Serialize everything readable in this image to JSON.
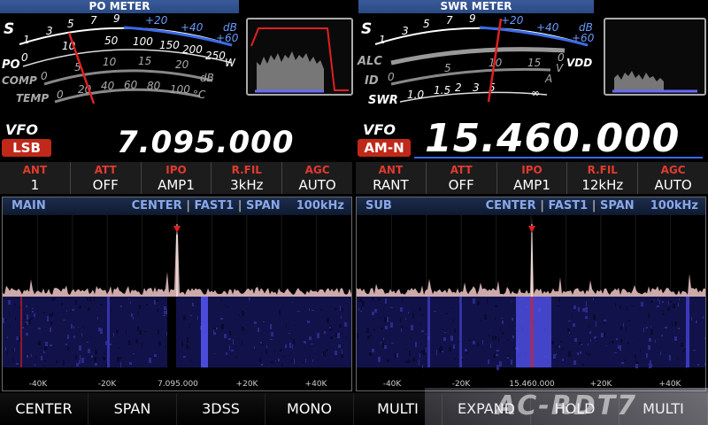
{
  "left_meter": {
    "title": "PO METER",
    "s_label": "S",
    "po_label": "PO",
    "comp_label": "COMP",
    "temp_label": "TEMP",
    "s_ticks": [
      "1",
      "3",
      "5",
      "7",
      "9",
      "+20",
      "+40",
      "+60"
    ],
    "s_unit": "dB",
    "po_ticks": [
      "0",
      "10",
      "50",
      "100",
      "150",
      "200",
      "250"
    ],
    "po_unit": "W",
    "comp_ticks": [
      "0",
      "5",
      "10",
      "15",
      "20"
    ],
    "comp_unit": "dB",
    "temp_ticks": [
      "0",
      "20",
      "40",
      "60",
      "80",
      "100"
    ],
    "temp_unit": "°C"
  },
  "right_meter": {
    "title": "SWR METER",
    "s_label": "S",
    "alc_label": "ALC",
    "id_label": "ID",
    "swr_label": "SWR",
    "vdd_label": "VDD",
    "s_ticks": [
      "1",
      "3",
      "5",
      "7",
      "9",
      "+20",
      "+40",
      "+60"
    ],
    "s_unit": "dB",
    "vdd_ticks": [
      "0",
      "50"
    ],
    "vdd_unit": "V",
    "id_ticks": [
      "0",
      "5",
      "10",
      "15"
    ],
    "id_unit": "A",
    "swr_ticks": [
      "1.0",
      "1.5",
      "2",
      "3",
      "5",
      "∞"
    ]
  },
  "main_vfo": {
    "label": "VFO",
    "mode": "LSB",
    "frequency": "7.095.000"
  },
  "sub_vfo": {
    "label": "VFO",
    "mode": "AM-N",
    "frequency": "15.460.000"
  },
  "main_settings": [
    {
      "label": "ANT",
      "value": "1"
    },
    {
      "label": "ATT",
      "value": "OFF"
    },
    {
      "label": "IPO",
      "value": "AMP1"
    },
    {
      "label": "R.FIL",
      "value": "3kHz"
    },
    {
      "label": "AGC",
      "value": "AUTO"
    }
  ],
  "sub_settings": [
    {
      "label": "ANT",
      "value": "RANT"
    },
    {
      "label": "ATT",
      "value": "OFF"
    },
    {
      "label": "IPO",
      "value": "AMP1"
    },
    {
      "label": "R.FIL",
      "value": "12kHz"
    },
    {
      "label": "AGC",
      "value": "AUTO"
    }
  ],
  "main_scope": {
    "name": "MAIN",
    "mode": "CENTER",
    "speed": "FAST1",
    "span_label": "SPAN",
    "span": "100kHz",
    "axis": [
      "-40K",
      "-20K",
      "7.095.000",
      "+20K",
      "+40K"
    ]
  },
  "sub_scope": {
    "name": "SUB",
    "mode": "CENTER",
    "speed": "FAST1",
    "span_label": "SPAN",
    "span": "100kHz",
    "axis": [
      "-40K",
      "-20K",
      "15.460.000",
      "+20K",
      "+40K"
    ]
  },
  "function_keys": [
    "CENTER",
    "SPAN",
    "3DSS",
    "MONO",
    "MULTI",
    "EXPAND",
    "HOLD",
    "MULTI"
  ],
  "watermark": "AC-RDT7",
  "colors": {
    "accent_red": "#c0281a",
    "label_red": "#e33a2e",
    "scope_blue": "#8aa8e8",
    "needle": "#e02020"
  }
}
